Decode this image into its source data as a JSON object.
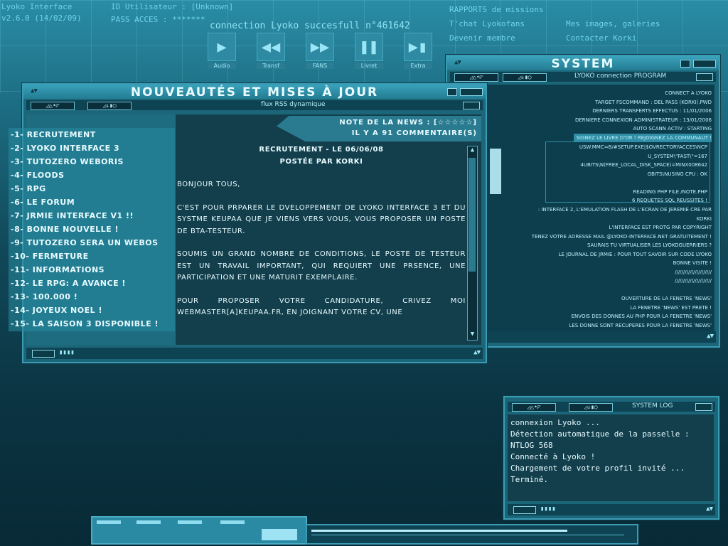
{
  "header": {
    "app_name": "Lyoko Interface",
    "version": "v2.6.0 (14/02/09)",
    "user_id": "ID Utilisateur : [Unknown]",
    "pass": "PASS ACCES  :  *******",
    "connection": "connection Lyoko succesfull n°461642",
    "links": {
      "rapports": "RAPPORTS de missions",
      "tchat": "T'chat Lyokofans",
      "images": "Mes images, galeries",
      "devenir": "Devenir membre",
      "contact": "Contacter Korki"
    },
    "media_buttons": [
      {
        "label": "Audio",
        "icon": "play-icon"
      },
      {
        "label": "Transf",
        "icon": "rewind-icon"
      },
      {
        "label": "FANS",
        "icon": "fast-forward-icon"
      },
      {
        "label": "Livret",
        "icon": "pause-icon"
      },
      {
        "label": "Extra",
        "icon": "skip-icon"
      }
    ]
  },
  "news_window": {
    "title": "Nouveautés et mises à jour",
    "subtitle": "flux RSS dynamique",
    "note": "Note de la news : [☆☆☆☆☆]",
    "comments": "Il y a 91 commentaire(s)",
    "items": [
      "-1- Recrutement",
      "-2- Lyoko Interface 3",
      "-3- Tutozero Weboris",
      "-4- Floods",
      "-5- RPG",
      "-6- Le forum",
      "-7- Jrmie Interface v1 !!",
      "-8- Bonne nouvelle !",
      "-9- Tutozero sera un Webos",
      "-10- Fermeture",
      "-11- Informations",
      "-12- Le RPG: a avance !",
      "-13- 100.000 !",
      "-14- Joyeux Noel !",
      "-15- La saison 3 disponible !"
    ],
    "article": {
      "heading": "Recrutement - le 06/06/08",
      "byline": "Postée par Korki",
      "paragraphs": [
        "Bonjour  tous,",
        "C'est pour prparer le dveloppement de Lyoko Interface 3 et du systme Keupaa que je viens vers vous, vous proposer un poste de bta-testeur.",
        "Soumis  un grand nombre de conditions, le poste de testeur est un travail important, qui requiert une prsence, une participation et une maturit exemplaire.",
        "Pour proposer votre candidature, crivez moi webmaster[a]keupaa.fr, en joignant votre CV, une"
      ]
    }
  },
  "system_window": {
    "title": "System",
    "subtitle": "LYOKO connection PROGRAM",
    "top_lines": [
      "Connect a Lyoko",
      "Target FSCommand : del pass (korki).pwd",
      "Derniers transferts effectus : 11/01/2006",
      "Derniere connexion administrateur : 13/01/2006",
      "Auto scann activ  : starting",
      "Signez le livre d'or ! Rejoignez la communaut !"
    ],
    "mid_lines": [
      "usw.mmc=b/#setup.exe|$ovrectoryacces\\ncp",
      "u_system\\\"fast\\\"=167",
      "4ubits\\n(free_local_disk_space)=minx008642",
      "gbits\\nusing cpu : ok",
      "",
      "Reading PHP file /note.php",
      "6 requetes SQL reussites !"
    ],
    "bottom_lines": [
      ": Interface 2, l'emulation flash de l'ecran de Jeremie cre par",
      "Korki",
      "L'interface est protg par copyright",
      "tenez votre adresse mail @lyoko-interface.net gratuitement !",
      "Saurais tu virtualiser les Lyokoguerriers ?",
      "Le journal de Jrmie : pour tout savoir sur Code Lyoko",
      "Bonne visite !",
      "//////////////////////",
      "//////////////////////",
      "",
      "Ouverture de la fenetre 'news'",
      "La fenetre 'news' est prete !",
      "Envois des donnes au PHP pour la fenetre 'news'",
      "Les donne sont recuperes pour la fenetre 'news'"
    ]
  },
  "log_window": {
    "title": "SYSTEM LOG",
    "lines": [
      "connexion Lyoko ...",
      "Détection automatique de la passelle :",
      "NTLOG 568",
      "Connecté à Lyoko !",
      "Chargement de votre profil invité ...",
      "Terminé."
    ]
  },
  "toolbar_glyphs": {
    "left": "◿△•◸",
    "right": "◿↓▮◯"
  }
}
